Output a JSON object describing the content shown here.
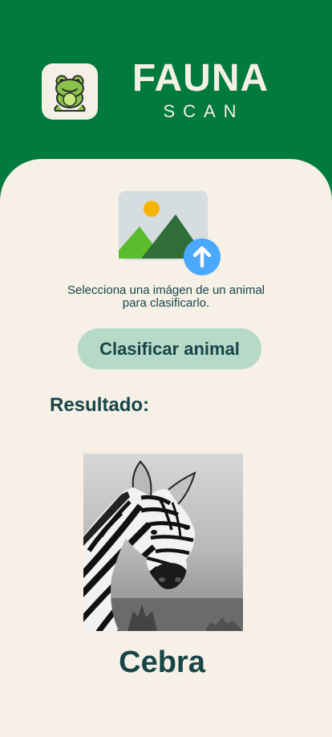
{
  "app": {
    "title": "FAUNA",
    "subtitle": "SCAN"
  },
  "upload": {
    "instruction_line1": "Selecciona una imágen de un animal",
    "instruction_line2": "para clasificarlo.",
    "icon": "image-upload-icon"
  },
  "actions": {
    "classify_label": "Clasificar animal"
  },
  "result": {
    "heading": "Resultado:",
    "animal_name": "Cebra"
  },
  "colors": {
    "header_green": "#007a3d",
    "panel_background": "#f6f0e6",
    "button_background": "#b7d9c7",
    "text_dark": "#174548",
    "upload_badge": "#4aa8ff"
  }
}
